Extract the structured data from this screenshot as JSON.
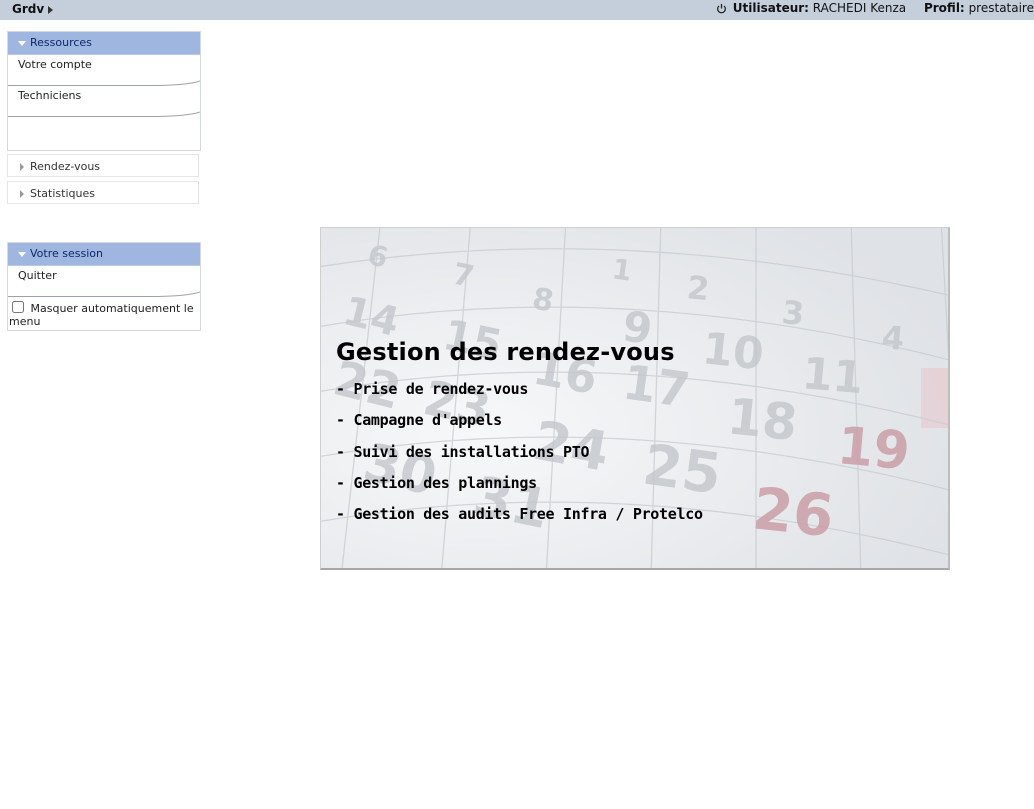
{
  "header": {
    "app_name": "Grdv",
    "user_label": "Utilisateur:",
    "user_name": "RACHEDI Kenza",
    "profile_label": "Profil:",
    "profile_value": "prestataire",
    "icon": "power-icon"
  },
  "sidebar": {
    "resources": {
      "title": "Ressources",
      "items": [
        "Votre compte",
        "Techniciens"
      ]
    },
    "rdv": {
      "label": "Rendez-vous"
    },
    "stats": {
      "label": "Statistiques"
    },
    "session": {
      "title": "Votre session",
      "items": [
        "Quitter"
      ],
      "auto_hide_label": "Masquer automatiquement le menu",
      "auto_hide_checked": false
    }
  },
  "hero": {
    "title": "Gestion des rendez-vous",
    "items": [
      "- Prise de rendez-vous",
      "- Campagne d'appels",
      "- Suivi des installations PTO",
      "- Gestion des plannings",
      "- Gestion des audits Free Infra / Protelco"
    ],
    "calendar_numbers": [
      "6",
      "7",
      "8",
      "1",
      "2",
      "3",
      "4",
      "14",
      "15",
      "9",
      "10",
      "11",
      "22",
      "23",
      "16",
      "17",
      "18",
      "19",
      "24",
      "25",
      "26",
      "30",
      "31"
    ]
  },
  "colors": {
    "topbar": "#c5cfdc",
    "panel_header": "#9fb6e0",
    "panel_header_text": "#0b2a6b",
    "calendar_red": "#c99aa3"
  }
}
